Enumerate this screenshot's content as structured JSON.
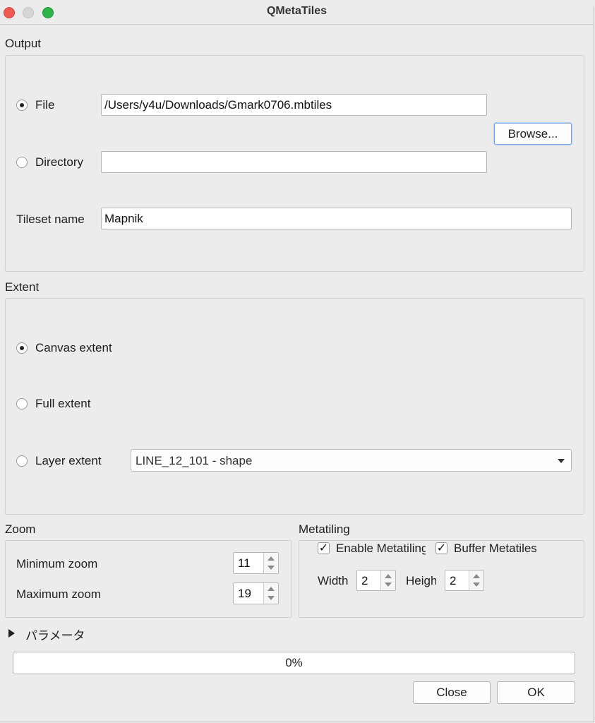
{
  "window": {
    "title": "QMetaTiles"
  },
  "output": {
    "section_label": "Output",
    "file_label": "File",
    "file_path": "/Users/y4u/Downloads/Gmark0706.mbtiles",
    "browse_label": "Browse...",
    "directory_label": "Directory",
    "directory_value": "",
    "tileset_label": "Tileset name",
    "tileset_value": "Mapnik"
  },
  "extent": {
    "section_label": "Extent",
    "canvas_label": "Canvas extent",
    "full_label": "Full extent",
    "layer_label": "Layer extent",
    "layer_selected": "LINE_12_101 - shape"
  },
  "zoom": {
    "section_label": "Zoom",
    "min_label": "Minimum zoom",
    "min_value": "11",
    "max_label": "Maximum zoom",
    "max_value": "19"
  },
  "metatiling": {
    "section_label": "Metatiling",
    "enable_label": "Enable Metatiling",
    "buffer_label": "Buffer Metatiles",
    "width_label": "Width",
    "width_value": "2",
    "height_label": "Height",
    "height_value": "2"
  },
  "parameters": {
    "label": "パラメータ"
  },
  "progress": {
    "value_percent": 0,
    "text": "0%"
  },
  "footer": {
    "close_label": "Close",
    "ok_label": "OK"
  },
  "colors": {
    "close_light": "#ee5b51",
    "minimize_light": "#d6d6d6",
    "zoom_light": "#2fb34a",
    "focus_ring": "#77a6e6"
  }
}
